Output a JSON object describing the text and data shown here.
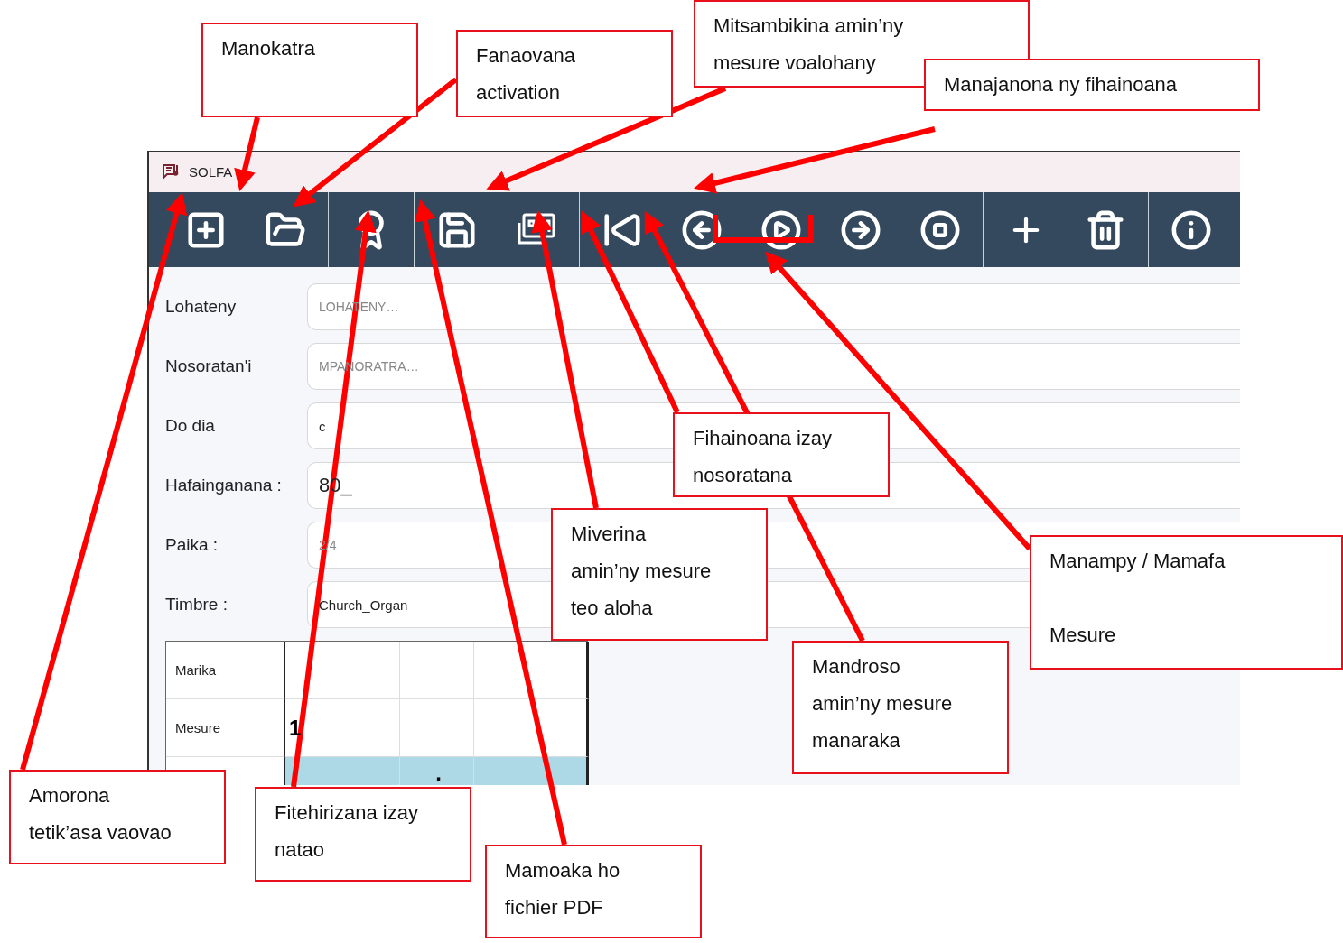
{
  "window": {
    "title": "SOLFA"
  },
  "form": [
    {
      "label": "Lohateny",
      "placeholder": "LOHATENY…"
    },
    {
      "label": "Nosoratan'i",
      "placeholder": "MPANORATRA…"
    },
    {
      "label": "Do dia",
      "value": "c"
    },
    {
      "label": "Hafainganana :",
      "value": "80_"
    },
    {
      "label": "Paika :",
      "placeholder": "2/4"
    },
    {
      "label": "Timbre :",
      "value": "Church_Organ"
    }
  ],
  "table": {
    "rows": [
      {
        "label": "Marika",
        "selected": false
      },
      {
        "label": "Mesure",
        "selected": false,
        "column_1": "1"
      },
      {
        "selected": true,
        "column_2": "."
      }
    ]
  },
  "callouts": [
    "Manokatra",
    "Fanaovana\nactivation",
    "Mitsambikina amin’ny\nmesure voalohany",
    "Manajanona ny fihainoana",
    "Fihainoana izay\nnosoratana",
    "Miverina\namin’ny mesure\nteo aloha",
    "Manampy / Mamafa\n\nMesure",
    "Mandroso\namin’ny mesure\nmanaraka",
    "Amorona\ntetik’asa vaovao",
    "Fitehirizana izay\nnatao",
    "Mamoaka ho\nfichier PDF"
  ]
}
